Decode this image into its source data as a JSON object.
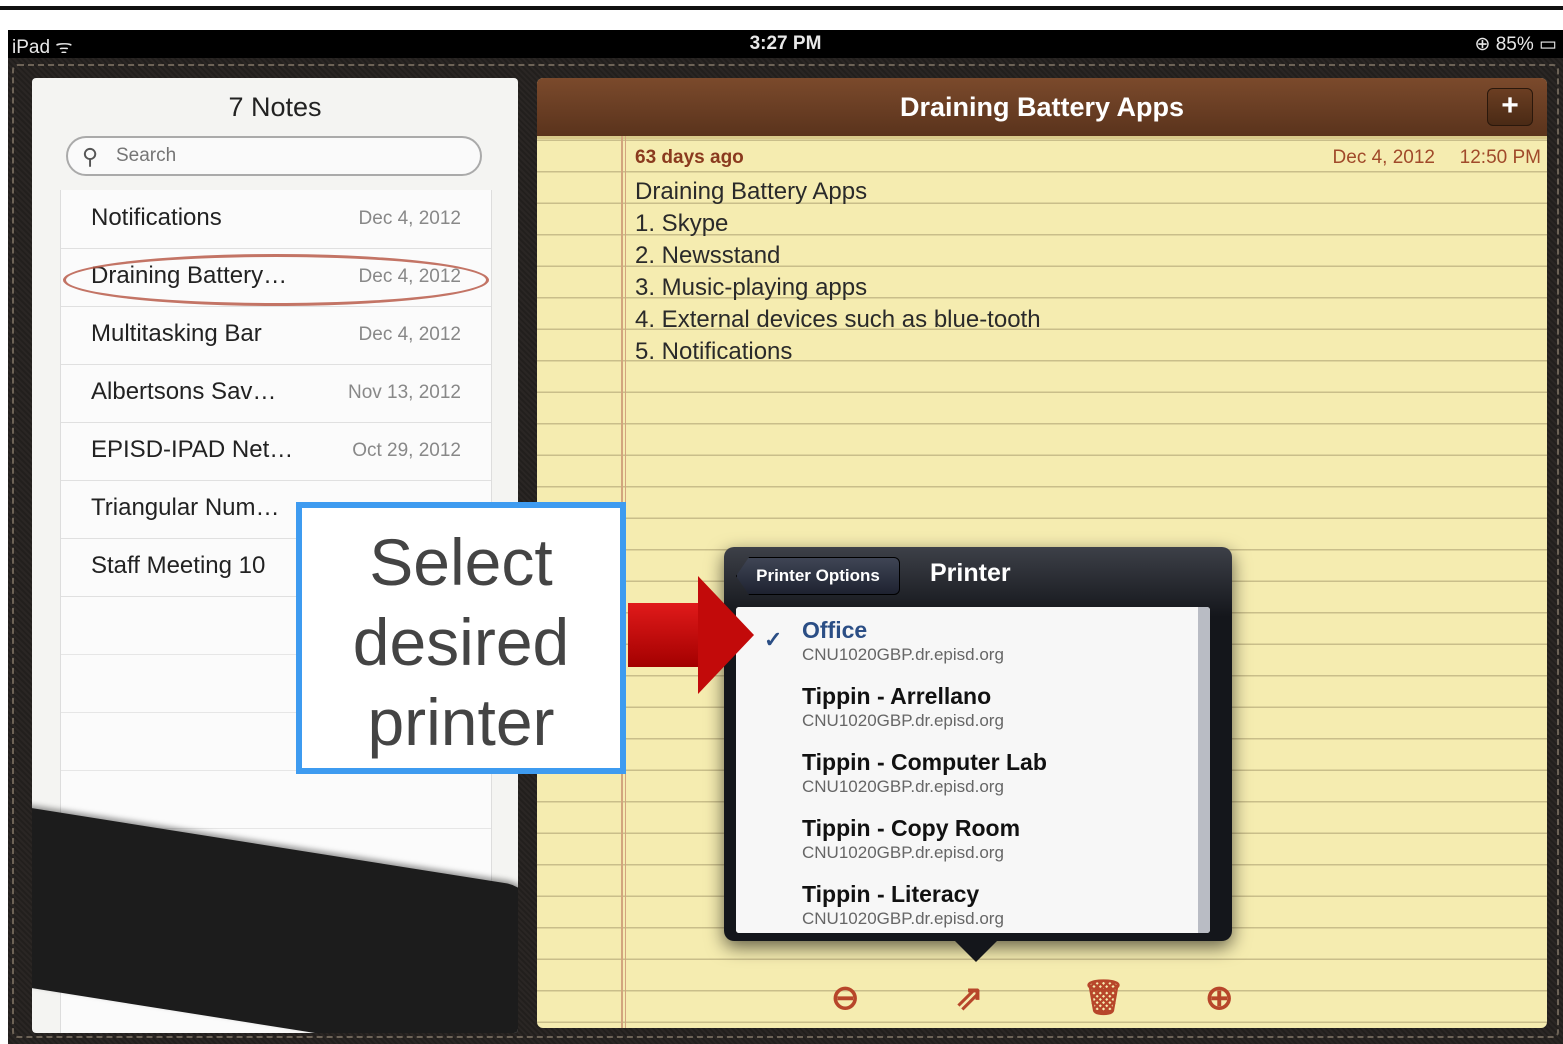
{
  "status_bar": {
    "carrier": "iPad ᯤ",
    "time": "3:27 PM",
    "battery": "⊕ 85% ▭"
  },
  "notes_list": {
    "title": "7 Notes",
    "search_placeholder": "Search",
    "items": [
      {
        "title": "Notifications",
        "date": "Dec 4, 2012"
      },
      {
        "title": "Draining Battery…",
        "date": "Dec 4, 2012"
      },
      {
        "title": "Multitasking Bar",
        "date": "Dec 4, 2012"
      },
      {
        "title": "Albertsons Sav…",
        "date": "Nov 13, 2012"
      },
      {
        "title": "EPISD-IPAD Net…",
        "date": "Oct 29, 2012"
      },
      {
        "title": "Triangular Num…",
        "date": ""
      },
      {
        "title": "Staff Meeting 10",
        "date": ""
      }
    ]
  },
  "note": {
    "header_title": "Draining Battery Apps",
    "plus_label": "+",
    "ago": "63 days ago",
    "date": "Dec 4, 2012",
    "time": "12:50 PM",
    "lines": [
      "Draining Battery Apps",
      "1.  Skype",
      "2.  Newsstand",
      "3.  Music-playing apps",
      "4.  External devices such as blue-tooth",
      "5.  Notifications"
    ]
  },
  "toolbar": {
    "prev": "⊖",
    "share": "⇗",
    "trash": "🗑",
    "next": "⊕"
  },
  "popover": {
    "back_label": "Printer Options",
    "title": "Printer",
    "check": "✓",
    "printers": [
      {
        "name": "Office",
        "host": "CNU1020GBP.dr.episd.org",
        "selected": true
      },
      {
        "name": "Tippin - Arrellano",
        "host": "CNU1020GBP.dr.episd.org",
        "selected": false
      },
      {
        "name": "Tippin - Computer Lab",
        "host": "CNU1020GBP.dr.episd.org",
        "selected": false
      },
      {
        "name": "Tippin - Copy Room",
        "host": "CNU1020GBP.dr.episd.org",
        "selected": false
      },
      {
        "name": "Tippin - Literacy",
        "host": "CNU1020GBP.dr.episd.org",
        "selected": false
      }
    ]
  },
  "callout": {
    "line1": "Select",
    "line2": "desired",
    "line3": "printer"
  },
  "colors": {
    "accent_blue": "#3e9bf0",
    "arrow_red": "#c20a0a",
    "note_brown": "#8a3a1e"
  }
}
